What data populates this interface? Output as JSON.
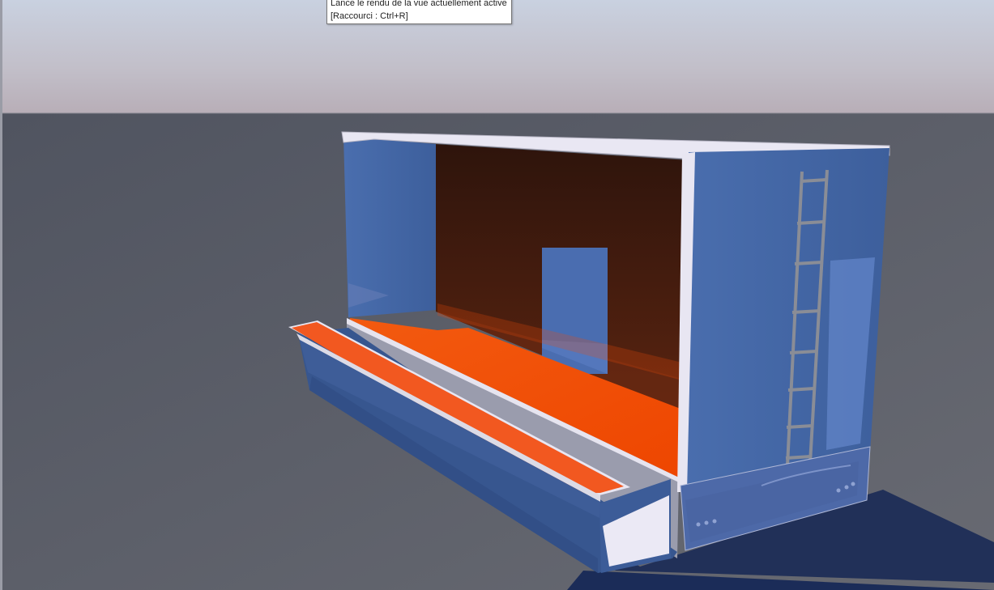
{
  "tooltip": {
    "line1": "Lance le rendu de la vue actuellement active",
    "line2": "[Raccourci : Ctrl+R]"
  },
  "colors": {
    "sky_top": "#c8d0df",
    "sky_bottom": "#bdb6be",
    "floor": "#5a5d66",
    "shell_blue": "#3f5f9c",
    "deck_orange": "#f04a08",
    "back_wall": "#3a1a10",
    "trim": "#e8e6f2"
  },
  "icons": [
    "render-tooltip"
  ]
}
